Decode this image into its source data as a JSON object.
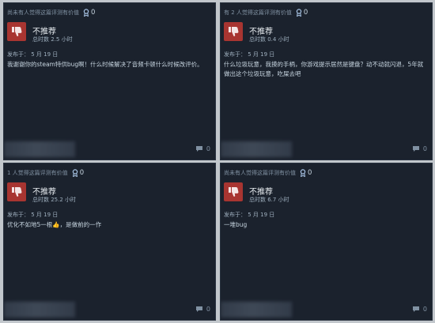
{
  "reviews": [
    {
      "helpful_text": "尚未有人觉得这篇评测有价值",
      "award_count": "0",
      "verdict": "不推荐",
      "hours": "总时数 2.5 小时",
      "posted": "发布于：  5 月 19 日",
      "body": "我谢谢你的steam特供bug啊！什么时候解决了音频卡顿什么时候改评价。",
      "comment_count": "0"
    },
    {
      "helpful_text": "有 2 人觉得这篇评测有价值",
      "award_count": "0",
      "verdict": "不推荐",
      "hours": "总时数 0.4 小时",
      "posted": "发布于：  5 月 19 日",
      "body": "什么垃圾玩意，我摸的手柄，你游戏提示居然是键盘？动不动就闪退，5年就做出这个垃圾玩意，吃屎去吧",
      "comment_count": "0"
    },
    {
      "helpful_text": "1 人觉得这篇评测有价值",
      "award_count": "0",
      "verdict": "不推荐",
      "hours": "总时数 25.2 小时",
      "posted": "发布于：  5 月 19 日",
      "body": "优化不如地5一根👍，是做前的一作",
      "comment_count": "0"
    },
    {
      "helpful_text": "尚未有人觉得这篇评测有价值",
      "award_count": "0",
      "verdict": "不推荐",
      "hours": "总时数 6.7 小时",
      "posted": "发布于：  5 月 19 日",
      "body": "一堆bug",
      "comment_count": "0"
    }
  ],
  "icons": {
    "thumbs_down": "thumbs-down-icon",
    "award": "award-icon",
    "comment": "comment-icon"
  },
  "colors": {
    "card_bg": "#1b222d",
    "thumb_bg": "#a83531",
    "page_bg": "#c2c7cc"
  }
}
